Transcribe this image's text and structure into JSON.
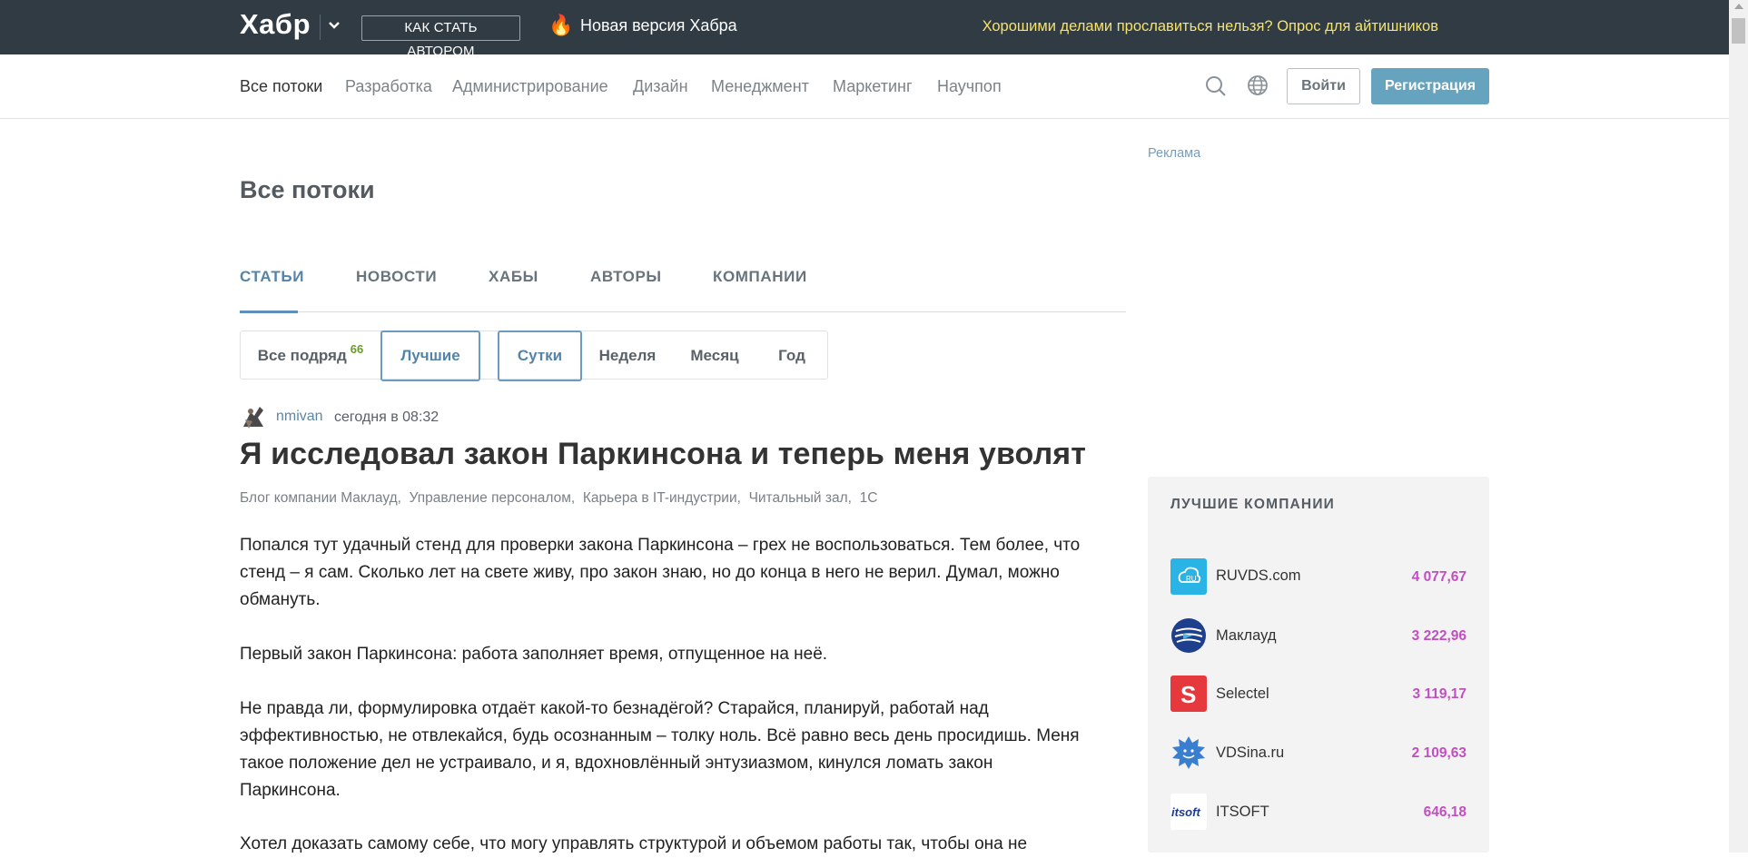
{
  "topbar": {
    "logo": "Хабр",
    "how_to_author": "КАК СТАТЬ АВТОРОМ",
    "new_version": "Новая версия Хабра",
    "promo": "Хорошими делами прославиться нельзя? Опрос для айтишников"
  },
  "nav": {
    "items": [
      "Все потоки",
      "Разработка",
      "Администрирование",
      "Дизайн",
      "Менеджмент",
      "Маркетинг",
      "Научпоп"
    ],
    "login": "Войти",
    "register": "Регистрация"
  },
  "page": {
    "title": "Все потоки",
    "tabs": [
      "СТАТЬИ",
      "НОВОСТИ",
      "ХАБЫ",
      "АВТОРЫ",
      "КОМПАНИИ"
    ],
    "filters": {
      "all": "Все подряд",
      "all_count": "66",
      "best": "Лучшие",
      "day": "Сутки",
      "week": "Неделя",
      "month": "Месяц",
      "year": "Год"
    }
  },
  "article": {
    "author": "nmivan",
    "time": "сегодня в 08:32",
    "title": "Я исследовал закон Паркинсона и теперь меня уволят",
    "hubs": [
      "Блог компании Маклауд,",
      "Управление персоналом,",
      "Карьера в IT-индустрии,",
      "Читальный зал,",
      "1С"
    ],
    "p1": [
      "Попался тут удачный стенд для проверки закона Паркинсона – грех не воспользоваться. Тем более, что",
      "стенд – я сам. Сколько лет на свете живу, про закон знаю, но до конца в него не верил. Думал, можно",
      "обмануть."
    ],
    "p2": "Первый закон Паркинсона: работа заполняет время, отпущенное на неё.",
    "p3": [
      "Не правда ли, формулировка отдаёт какой-то безнадёгой? Старайся, планируй, работай над",
      "эффективностью, не отвлекайся, будь осознанным – толку ноль. Всё равно весь день просидишь. Меня",
      "такое положение дел не устраивало, и я, вдохновлённый энтузиазмом, кинулся ломать закон",
      "Паркинсона."
    ],
    "p4": "Хотел доказать самому себе, что могу управлять структурой и объемом работы так, чтобы она не"
  },
  "sidebar": {
    "ad_label": "Реклама",
    "companies_title": "ЛУЧШИЕ КОМПАНИИ",
    "companies": [
      {
        "name": "RUVDS.com",
        "rating": "4 077,67",
        "color": "#2ab4e6"
      },
      {
        "name": "Маклауд",
        "rating": "3 222,96",
        "color": "#1e3f8c"
      },
      {
        "name": "Selectel",
        "rating": "3 119,17",
        "color": "#e5393d"
      },
      {
        "name": "VDSina.ru",
        "rating": "2 109,63",
        "color": "#3a7ed0"
      },
      {
        "name": "ITSOFT",
        "rating": "646,18",
        "color": "#1c3c8e"
      }
    ]
  },
  "colors": {
    "topbar_bg": "#303b44",
    "accent": "#5484a8",
    "register_bg": "#65a3be",
    "rating": "#c24fc1",
    "promo": "#f7e26b"
  }
}
